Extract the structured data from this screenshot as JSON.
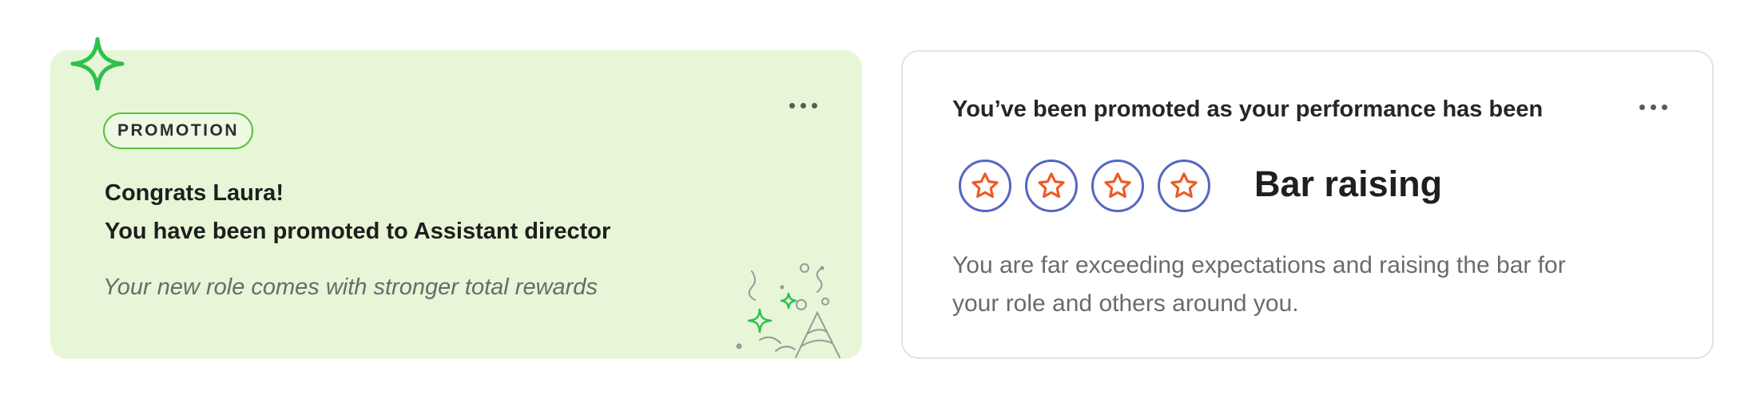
{
  "promotion_card": {
    "badge": "PROMOTION",
    "congrats_line": "Congrats Laura!",
    "promotion_line": "You have been promoted to Assistant director",
    "subtext": "Your new role comes with stronger total rewards",
    "colors": {
      "background": "#e6f6d6",
      "accent": "#2ec04f",
      "badge_border": "#5cbf3a"
    },
    "icons": [
      "sparkle-icon",
      "more-options-icon",
      "party-popper-icon"
    ]
  },
  "performance_card": {
    "title": "You’ve been promoted as your performance has been",
    "rating_label": "Bar raising",
    "stars_filled": 4,
    "stars_total": 4,
    "description": "You are far exceeding expectations and raising the bar for your role and others around you.",
    "colors": {
      "star": "#ee5a24",
      "star_ring": "#5566c2"
    },
    "icons": [
      "star-icon",
      "more-options-icon"
    ]
  }
}
